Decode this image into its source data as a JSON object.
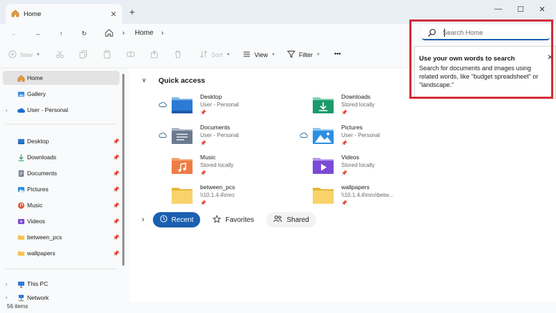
{
  "window": {
    "tab_title": "Home",
    "tab_close": "✕",
    "new_tab": "+",
    "controls": {
      "minimize": "—",
      "maximize": "☐",
      "close": "✕"
    }
  },
  "address": {
    "back": "←",
    "forward": "→",
    "up": "↑",
    "refresh": "↻",
    "crumb_sep": "›",
    "crumb": "Home",
    "crumb_trailing": "›"
  },
  "search": {
    "placeholder": "Search Home",
    "tooltip_title": "Use your own words to search",
    "tooltip_body": "Search for documents and images using related words, like \"budget spreadsheet\" or \"landscape.\"",
    "tooltip_close": "✕",
    "highlight_color": "#d22b36"
  },
  "commands": {
    "new": "New",
    "sort": "Sort",
    "view": "View",
    "filter": "Filter",
    "more": "•••"
  },
  "sidebar": {
    "top": [
      {
        "label": "Home",
        "icon": "home-icon",
        "selected": true
      },
      {
        "label": "Gallery",
        "icon": "gallery-icon"
      },
      {
        "label": "User - Personal",
        "icon": "onedrive-cloud-icon",
        "expandable": true
      }
    ],
    "pinned": [
      {
        "label": "Desktop",
        "icon": "desktop-folder-icon"
      },
      {
        "label": "Downloads",
        "icon": "downloads-icon"
      },
      {
        "label": "Documents",
        "icon": "documents-icon"
      },
      {
        "label": "Pictures",
        "icon": "pictures-icon"
      },
      {
        "label": "Music",
        "icon": "music-icon"
      },
      {
        "label": "Videos",
        "icon": "videos-icon"
      },
      {
        "label": "between_pcs",
        "icon": "folder-icon"
      },
      {
        "label": "wallpapers",
        "icon": "folder-icon"
      }
    ],
    "bottom": [
      {
        "label": "This PC",
        "icon": "this-pc-icon"
      },
      {
        "label": "Network",
        "icon": "network-icon"
      }
    ],
    "pin_glyph": "📌"
  },
  "quick_access": {
    "title": "Quick access",
    "items": [
      {
        "name": "Desktop",
        "sub": "User - Personal",
        "icon": "desktop-folder-icon",
        "cloud": true
      },
      {
        "name": "Downloads",
        "sub": "Stored locally",
        "icon": "downloads-folder-icon",
        "cloud": false
      },
      {
        "name": "Documents",
        "sub": "User - Personal",
        "icon": "documents-folder-icon",
        "cloud": true
      },
      {
        "name": "Pictures",
        "sub": "User - Personal",
        "icon": "pictures-folder-icon",
        "cloud": true
      },
      {
        "name": "Music",
        "sub": "Stored locally",
        "icon": "music-folder-icon",
        "cloud": false
      },
      {
        "name": "Videos",
        "sub": "Stored locally",
        "icon": "videos-folder-icon",
        "cloud": false
      },
      {
        "name": "between_pcs",
        "sub": "\\\\10.1.4.4\\mro",
        "icon": "network-folder-icon",
        "cloud": false
      },
      {
        "name": "wallpapers",
        "sub": "\\\\10.1.4.4\\mro\\betw...",
        "icon": "network-folder-icon",
        "cloud": false
      }
    ],
    "pin_glyph": "📌"
  },
  "chips": {
    "recent": "Recent",
    "favorites": "Favorites",
    "shared": "Shared"
  },
  "status": {
    "items": "56 items"
  },
  "colors": {
    "accent": "#1a5fb0",
    "titlebar": "#e9eef5",
    "pane": "#f9fafb"
  }
}
